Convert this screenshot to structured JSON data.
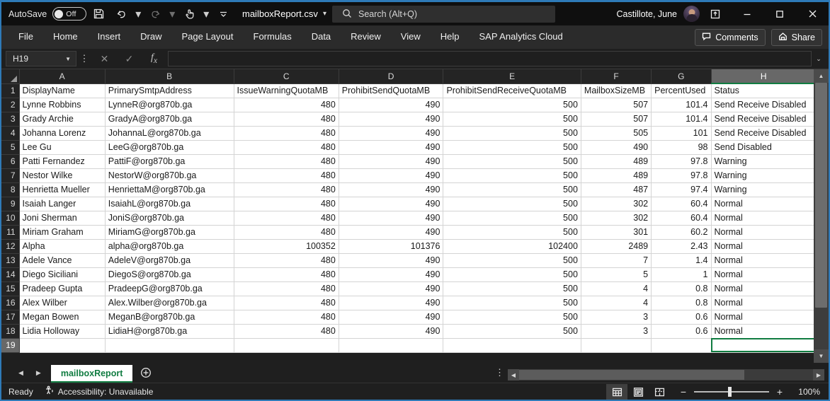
{
  "titlebar": {
    "autosave_label": "AutoSave",
    "autosave_state": "Off",
    "save_icon": "save-icon",
    "undo_icon": "undo-icon",
    "redo_icon": "redo-icon",
    "touch_icon": "touch-mode-icon",
    "customize_icon": "customize-quick-access-icon",
    "document_title": "mailboxReport.csv",
    "title_chevron": "chevron-down-icon",
    "search_placeholder": "Search (Alt+Q)",
    "search_icon": "search-icon",
    "user_name": "Castillote, June",
    "ribbon_display_icon": "ribbon-display-options-icon",
    "minimize": "minimize-icon",
    "maximize": "maximize-icon",
    "close": "close-icon"
  },
  "ribbon": {
    "tabs": [
      "File",
      "Home",
      "Insert",
      "Draw",
      "Page Layout",
      "Formulas",
      "Data",
      "Review",
      "View",
      "Help",
      "SAP Analytics Cloud"
    ],
    "comments_label": "Comments",
    "share_label": "Share"
  },
  "formula_bar": {
    "name_box_value": "H19",
    "cancel_icon": "cancel-icon",
    "enter_icon": "confirm-check-icon",
    "function_icon": "insert-function-icon",
    "formula_value": "",
    "expand_icon": "expand-formula-bar-icon"
  },
  "grid": {
    "column_letters": [
      "A",
      "B",
      "C",
      "D",
      "E",
      "F",
      "G",
      "H"
    ],
    "selected_column": "H",
    "selected_cell": "H19",
    "row_numbers": [
      1,
      2,
      3,
      4,
      5,
      6,
      7,
      8,
      9,
      10,
      11,
      12,
      13,
      14,
      15,
      16,
      17,
      18,
      19
    ],
    "headers": [
      "DisplayName",
      "PrimarySmtpAddress",
      "IssueWarningQuotaMB",
      "ProhibitSendQuotaMB",
      "ProhibitSendReceiveQuotaMB",
      "MailboxSizeMB",
      "PercentUsed",
      "Status"
    ],
    "rows": [
      [
        "Lynne Robbins",
        "LynneR@org870b.ga",
        "480",
        "490",
        "500",
        "507",
        "101.4",
        "Send Receive Disabled"
      ],
      [
        "Grady Archie",
        "GradyA@org870b.ga",
        "480",
        "490",
        "500",
        "507",
        "101.4",
        "Send Receive Disabled"
      ],
      [
        "Johanna Lorenz",
        "JohannaL@org870b.ga",
        "480",
        "490",
        "500",
        "505",
        "101",
        "Send Receive Disabled"
      ],
      [
        "Lee Gu",
        "LeeG@org870b.ga",
        "480",
        "490",
        "500",
        "490",
        "98",
        "Send Disabled"
      ],
      [
        "Patti Fernandez",
        "PattiF@org870b.ga",
        "480",
        "490",
        "500",
        "489",
        "97.8",
        "Warning"
      ],
      [
        "Nestor Wilke",
        "NestorW@org870b.ga",
        "480",
        "490",
        "500",
        "489",
        "97.8",
        "Warning"
      ],
      [
        "Henrietta Mueller",
        "HenriettaM@org870b.ga",
        "480",
        "490",
        "500",
        "487",
        "97.4",
        "Warning"
      ],
      [
        "Isaiah Langer",
        "IsaiahL@org870b.ga",
        "480",
        "490",
        "500",
        "302",
        "60.4",
        "Normal"
      ],
      [
        "Joni Sherman",
        "JoniS@org870b.ga",
        "480",
        "490",
        "500",
        "302",
        "60.4",
        "Normal"
      ],
      [
        "Miriam Graham",
        "MiriamG@org870b.ga",
        "480",
        "490",
        "500",
        "301",
        "60.2",
        "Normal"
      ],
      [
        "Alpha",
        "alpha@org870b.ga",
        "100352",
        "101376",
        "102400",
        "2489",
        "2.43",
        "Normal"
      ],
      [
        "Adele Vance",
        "AdeleV@org870b.ga",
        "480",
        "490",
        "500",
        "7",
        "1.4",
        "Normal"
      ],
      [
        "Diego Siciliani",
        "DiegoS@org870b.ga",
        "480",
        "490",
        "500",
        "5",
        "1",
        "Normal"
      ],
      [
        "Pradeep Gupta",
        "PradeepG@org870b.ga",
        "480",
        "490",
        "500",
        "4",
        "0.8",
        "Normal"
      ],
      [
        "Alex Wilber",
        "Alex.Wilber@org870b.ga",
        "480",
        "490",
        "500",
        "4",
        "0.8",
        "Normal"
      ],
      [
        "Megan Bowen",
        "MeganB@org870b.ga",
        "480",
        "490",
        "500",
        "3",
        "0.6",
        "Normal"
      ],
      [
        "Lidia Holloway",
        "LidiaH@org870b.ga",
        "480",
        "490",
        "500",
        "3",
        "0.6",
        "Normal"
      ]
    ],
    "empty_row": [
      "",
      "",
      "",
      "",
      "",
      "",
      "",
      ""
    ]
  },
  "sheet_tabs": {
    "prev_icon": "previous-sheet-icon",
    "next_icon": "next-sheet-icon",
    "tabs": [
      "mailboxReport"
    ],
    "active_tab": "mailboxReport",
    "add_sheet_icon": "add-sheet-icon"
  },
  "statusbar": {
    "mode": "Ready",
    "accessibility_icon": "accessibility-icon",
    "accessibility_label": "Accessibility: Unavailable",
    "view_normal_icon": "normal-view-icon",
    "view_pagelayout_icon": "page-layout-view-icon",
    "view_pagebreak_icon": "page-break-preview-icon",
    "zoom_out_label": "−",
    "zoom_in_label": "+",
    "zoom_value": "100%"
  },
  "colors": {
    "accent_green": "#107c41",
    "window_border": "#2e7ab8",
    "titlebar_bg": "#0f0f0f",
    "ribbon_bg": "#2b2b2b",
    "cell_bg": "#ffffff"
  }
}
